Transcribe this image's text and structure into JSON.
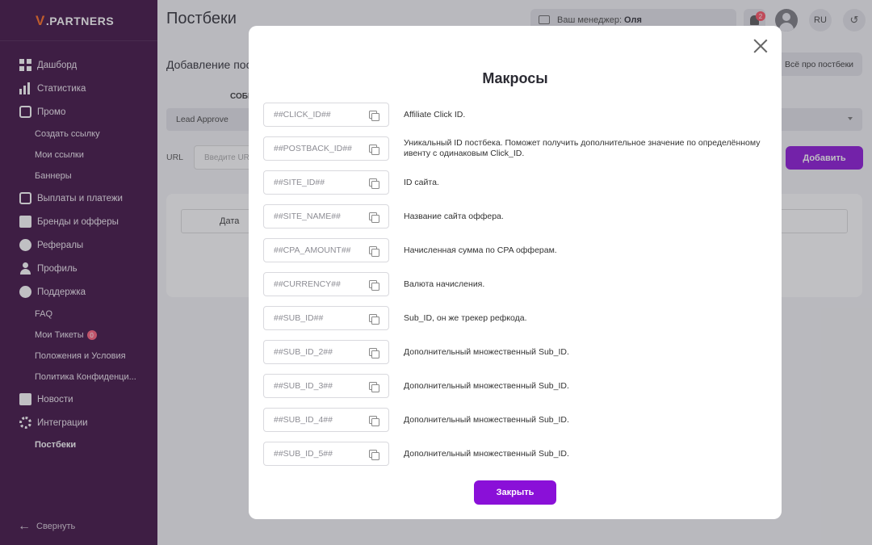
{
  "sidebar": {
    "logo_v": "V",
    "logo_text": ".PARTNERS",
    "items": [
      {
        "label": "Дашборд",
        "icon": "dashboard-icon"
      },
      {
        "label": "Статистика",
        "icon": "statistics-icon"
      },
      {
        "label": "Промо",
        "icon": "promo-icon"
      },
      {
        "label": "Создать ссылку"
      },
      {
        "label": "Мои ссылки"
      },
      {
        "label": "Баннеры"
      },
      {
        "label": "Выплаты и платежи",
        "icon": "wallet-icon"
      },
      {
        "label": "Бренды и офферы",
        "icon": "brands-icon"
      },
      {
        "label": "Рефералы",
        "icon": "handshake-icon"
      },
      {
        "label": "Профиль",
        "icon": "profile-icon"
      },
      {
        "label": "Поддержка",
        "icon": "support-icon"
      },
      {
        "label": "FAQ"
      },
      {
        "label": "Мои Тикеты",
        "badge": "0"
      },
      {
        "label": "Положения и Условия"
      },
      {
        "label": "Политика Конфиденци..."
      },
      {
        "label": "Новости",
        "icon": "news-icon"
      },
      {
        "label": "Интеграции",
        "icon": "integrations-icon"
      },
      {
        "label": "Постбеки"
      }
    ],
    "collapse_label": "Свернуть"
  },
  "header": {
    "title": "Постбеки",
    "manager_label": "Ваш менеджер:",
    "manager_name": "Оля",
    "notifications_count": "2",
    "lang": "RU"
  },
  "form": {
    "section_title": "Добавление пос",
    "about_button": "Всё про постбеки",
    "event_label": "СОБЫ",
    "event_value": "Lead Approve",
    "url_label": "URL",
    "url_placeholder": "Введите UR",
    "add_button": "Добавить"
  },
  "table": {
    "col_date": "Дата"
  },
  "modal": {
    "title": "Макросы",
    "close_button": "Закрыть",
    "macros": [
      {
        "code": "##CLICK_ID##",
        "desc": "Affiliate Click ID."
      },
      {
        "code": "##POSTBACK_ID##",
        "desc": "Уникальный ID постбека. Поможет получить дополнительное значение по определённому ивенту с одинаковым Click_ID."
      },
      {
        "code": "##SITE_ID##",
        "desc": "ID сайта."
      },
      {
        "code": "##SITE_NAME##",
        "desc": "Название сайта оффера."
      },
      {
        "code": "##CPA_AMOUNT##",
        "desc": "Начисленная сумма по CPA офферам."
      },
      {
        "code": "##CURRENCY##",
        "desc": "Валюта начисления."
      },
      {
        "code": "##SUB_ID##",
        "desc": "Sub_ID, он же трекер рефкода."
      },
      {
        "code": "##SUB_ID_2##",
        "desc": "Дополнительный множественный Sub_ID."
      },
      {
        "code": "##SUB_ID_3##",
        "desc": "Дополнительный множественный Sub_ID."
      },
      {
        "code": "##SUB_ID_4##",
        "desc": "Дополнительный множественный Sub_ID."
      },
      {
        "code": "##SUB_ID_5##",
        "desc": "Дополнительный множественный Sub_ID."
      }
    ]
  },
  "colors": {
    "sidebar_bg": "#3b0a3f",
    "accent": "#8a10d8",
    "logo_accent": "#ff6a1a",
    "badge": "#ff4d5e"
  }
}
